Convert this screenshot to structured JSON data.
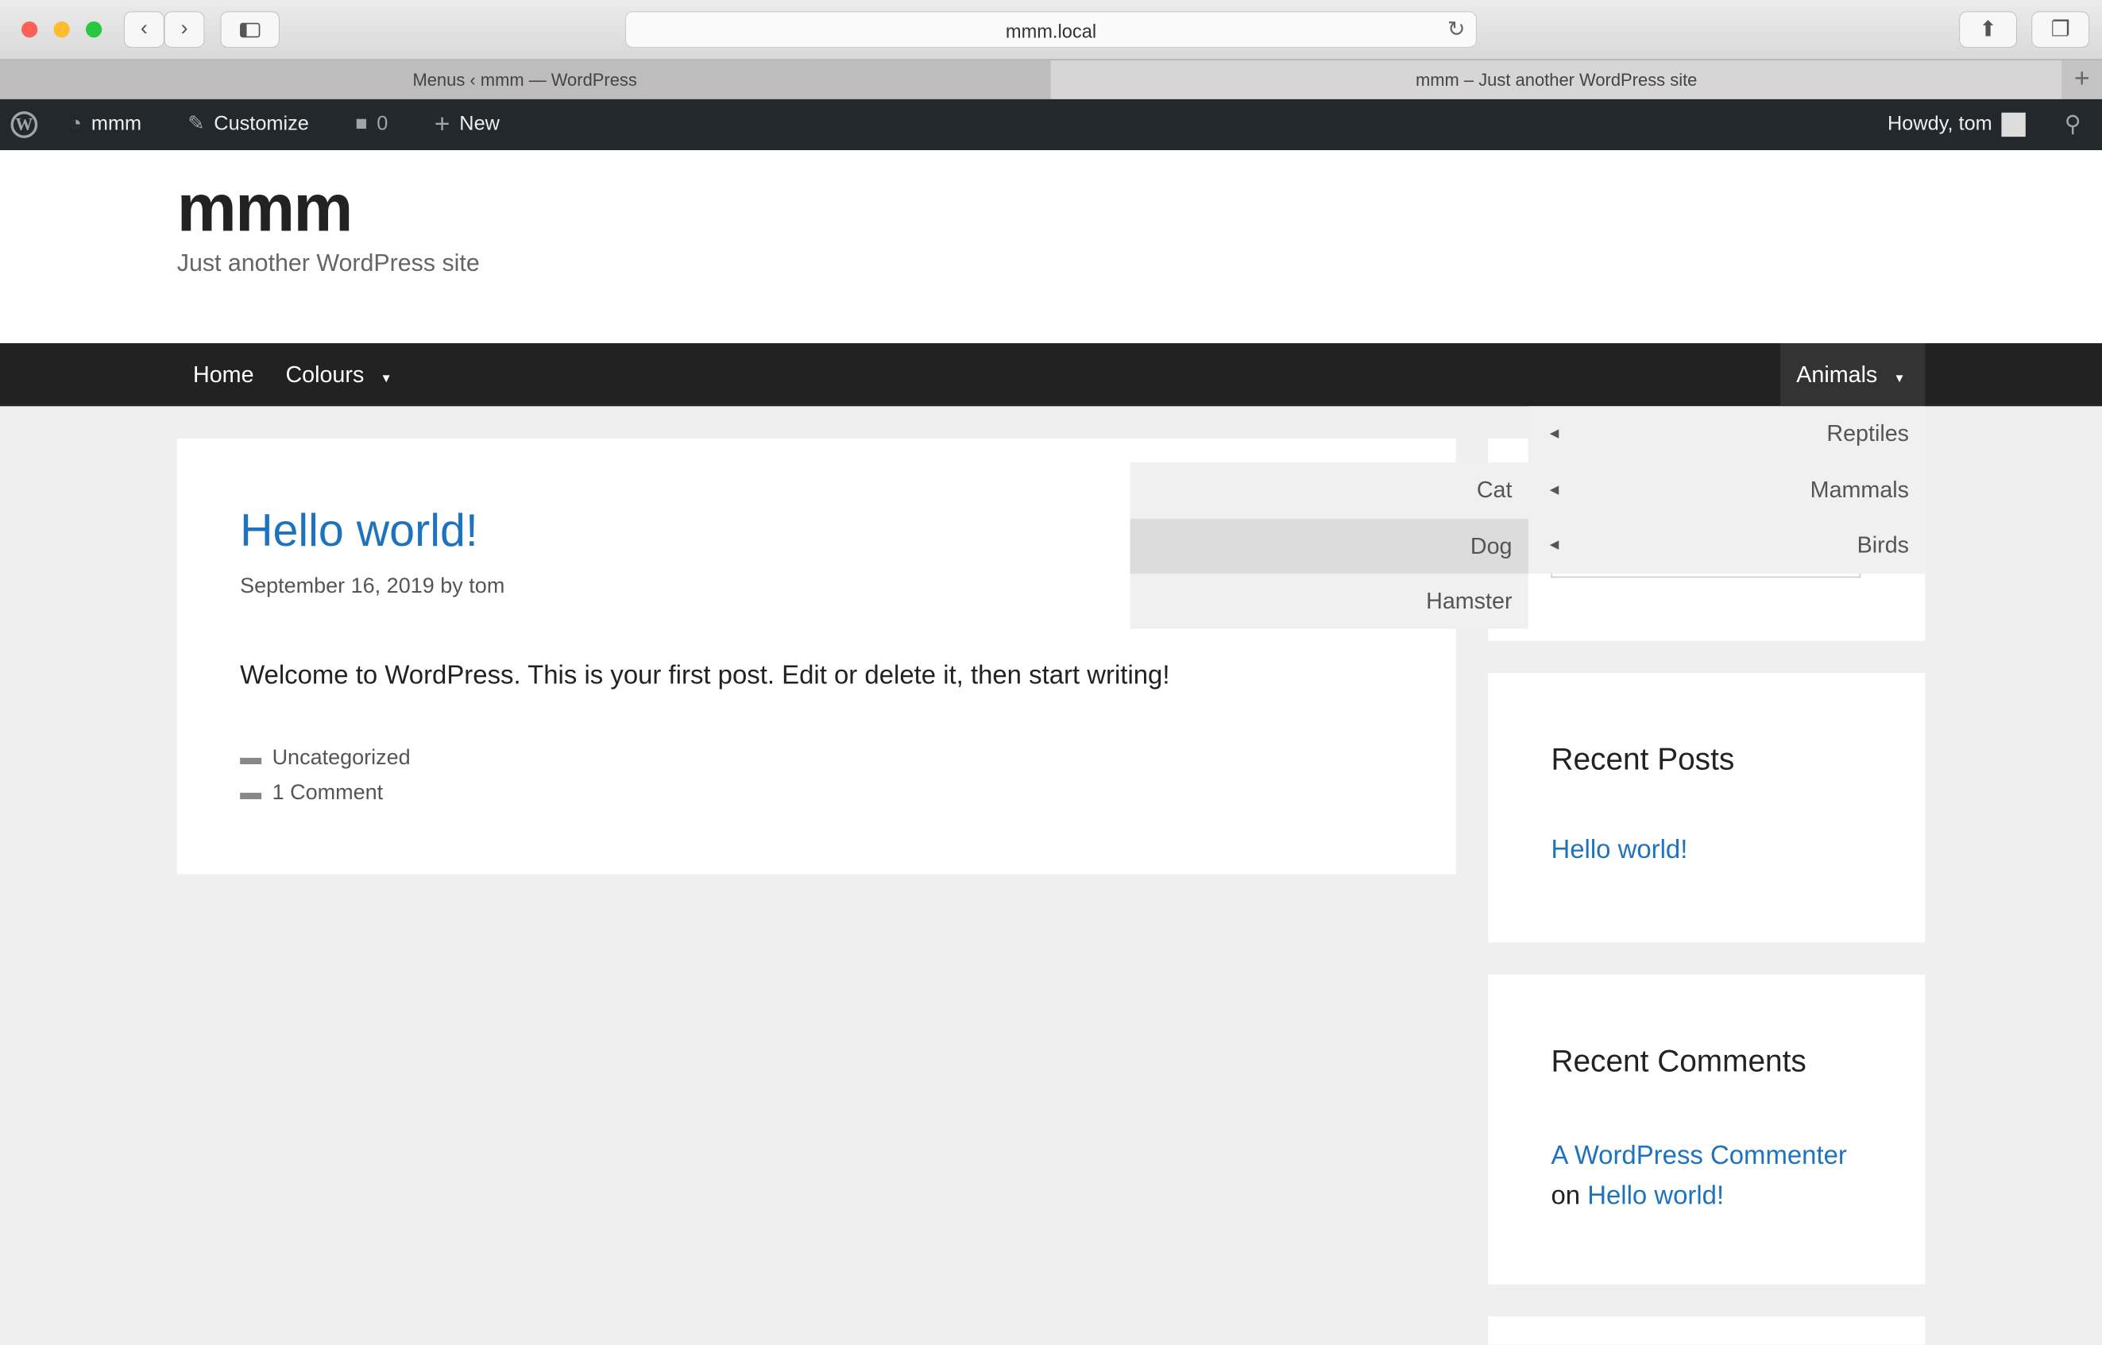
{
  "browser": {
    "url": "mmm.local",
    "tabs": [
      {
        "label": "Menus ‹ mmm — WordPress",
        "active": false
      },
      {
        "label": "mmm – Just another WordPress site",
        "active": true
      }
    ]
  },
  "adminbar": {
    "site": "mmm",
    "customize": "Customize",
    "comments": "0",
    "new": "New",
    "howdy": "Howdy, tom"
  },
  "site": {
    "title": "mmm",
    "tagline": "Just another WordPress site"
  },
  "nav": {
    "items": [
      "Home",
      "Colours",
      "Animals"
    ]
  },
  "animals_menu": [
    "Reptiles",
    "Mammals",
    "Birds"
  ],
  "mammals_menu": [
    "Cat",
    "Dog",
    "Hamster"
  ],
  "post": {
    "title": "Hello world!",
    "date": "September 16, 2019",
    "by": "by",
    "author": "tom",
    "body": "Welcome to WordPress. This is your first post. Edit or delete it, then start writing!",
    "category": "Uncategorized",
    "comments": "1 Comment"
  },
  "widgets": {
    "recent_posts": {
      "title": "Recent Posts",
      "items": [
        "Hello world!"
      ]
    },
    "recent_comments": {
      "title": "Recent Comments",
      "author": "A WordPress Commenter",
      "on": "on",
      "post": "Hello world!"
    }
  },
  "colors": {
    "link": "#1e73be",
    "adminbar": "#23282d",
    "nav": "#222222"
  }
}
